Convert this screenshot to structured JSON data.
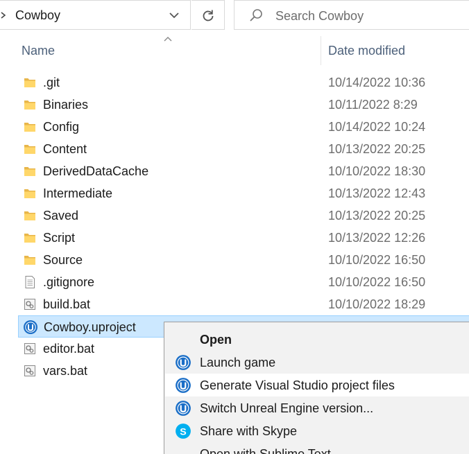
{
  "address_bar": {
    "path": "Cowboy",
    "chevron_icon": "chevron-right-icon",
    "dropdown_icon": "chevron-down-icon"
  },
  "refresh": {
    "icon": "refresh-icon"
  },
  "search": {
    "placeholder": "Search Cowboy",
    "icon": "search-icon"
  },
  "columns": {
    "name": "Name",
    "date_modified": "Date modified",
    "sort_icon": "sort-ascending-icon"
  },
  "files": [
    {
      "name": ".git",
      "date": "10/14/2022 10:36",
      "type": "folder"
    },
    {
      "name": "Binaries",
      "date": "10/11/2022 8:29",
      "type": "folder"
    },
    {
      "name": "Config",
      "date": "10/14/2022 10:24",
      "type": "folder"
    },
    {
      "name": "Content",
      "date": "10/13/2022 20:25",
      "type": "folder"
    },
    {
      "name": "DerivedDataCache",
      "date": "10/10/2022 18:30",
      "type": "folder"
    },
    {
      "name": "Intermediate",
      "date": "10/13/2022 12:43",
      "type": "folder"
    },
    {
      "name": "Saved",
      "date": "10/13/2022 20:25",
      "type": "folder"
    },
    {
      "name": "Script",
      "date": "10/13/2022 12:26",
      "type": "folder"
    },
    {
      "name": "Source",
      "date": "10/10/2022 16:50",
      "type": "folder"
    },
    {
      "name": ".gitignore",
      "date": "10/10/2022 16:50",
      "type": "text-file"
    },
    {
      "name": "build.bat",
      "date": "10/10/2022 18:29",
      "type": "batch-file"
    },
    {
      "name": "Cowboy.uproject",
      "date": "",
      "type": "unreal-project",
      "selected": true
    },
    {
      "name": "editor.bat",
      "date": "",
      "type": "batch-file"
    },
    {
      "name": "vars.bat",
      "date": "",
      "type": "batch-file"
    }
  ],
  "context_menu": {
    "items": [
      {
        "label": "Open",
        "icon": "",
        "bold": true
      },
      {
        "label": "Launch game",
        "icon": "unreal-engine-icon"
      },
      {
        "label": "Generate Visual Studio project files",
        "icon": "unreal-engine-icon",
        "hover": true
      },
      {
        "label": "Switch Unreal Engine version...",
        "icon": "unreal-engine-icon"
      },
      {
        "label": "Share with Skype",
        "icon": "skype-icon"
      },
      {
        "label": "Open with Sublime Text",
        "icon": ""
      }
    ]
  },
  "colors": {
    "selection_bg": "#cce8ff",
    "selection_border": "#99d1ff",
    "header_text": "#4c607a",
    "unreal_blue": "#1a6ec7",
    "skype_blue": "#00aff0",
    "folder_yellow": "#ffd76a"
  }
}
